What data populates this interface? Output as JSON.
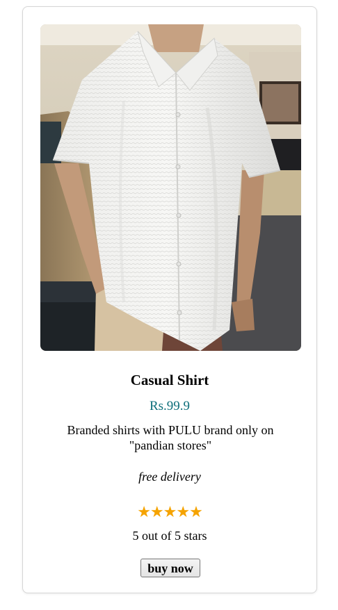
{
  "product": {
    "image_alt": "man wearing white textured short-sleeve shirt",
    "title": "Casual Shirt",
    "price": "Rs.99.9",
    "description": "Branded shirts with PULU brand only on \"pandian stores\"",
    "delivery": "free delivery",
    "rating": {
      "value": 5,
      "max": 5,
      "stars": "★★★★★",
      "text": "5 out of 5 stars"
    },
    "buy_label": "buy now"
  },
  "colors": {
    "price": "#0d6e7a",
    "stars": "#f5a300",
    "card_border": "#d6d6d6"
  }
}
